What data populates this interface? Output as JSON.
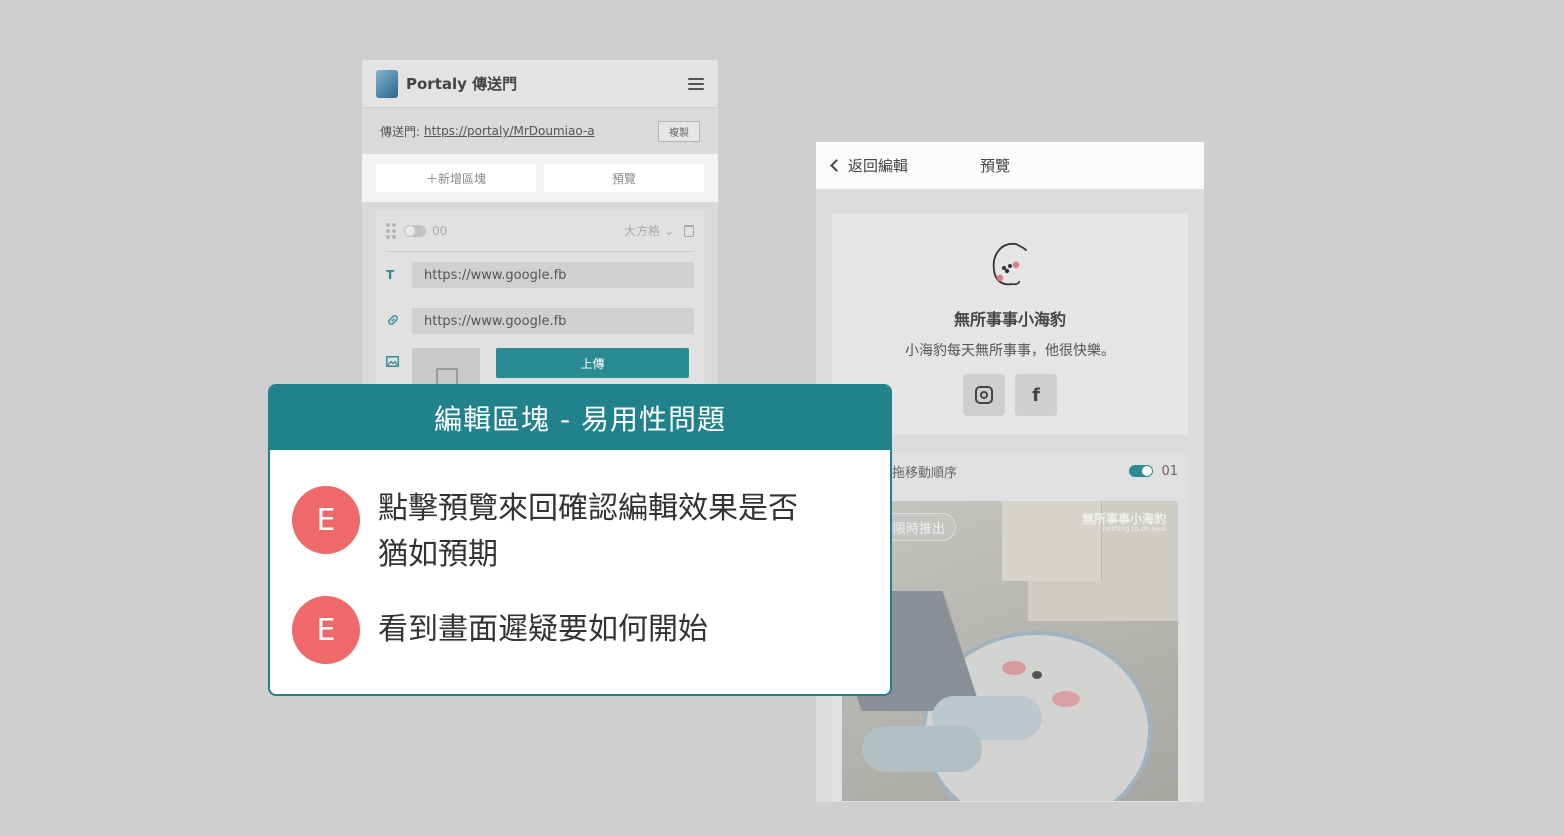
{
  "editor": {
    "app_name": "Portaly 傳送門",
    "portal_label": "傳送門:",
    "portal_url": "https://portaly/MrDoumiao-a",
    "copy_label": "複製",
    "add_block_label": "＋新增區塊",
    "preview_label": "預覽",
    "block": {
      "index": "00",
      "size_label": "大方格 ⌄",
      "title_value": "https://www.google.fb",
      "link_value": "https://www.google.fb",
      "upload_label": "上傳"
    }
  },
  "preview": {
    "back_label": "返回編輯",
    "title": "預覽",
    "profile": {
      "name": "無所事事小海豹",
      "description": "小海豹每天無所事事，他很快樂。",
      "socials": [
        "instagram-icon",
        "facebook-icon"
      ],
      "facebook_glyph": "f"
    },
    "media_block": {
      "drag_label": "拖移動順序",
      "index": "01",
      "tag": "限時推出",
      "watermark": "無所事事小海豹",
      "watermark_sub": "nothing to do seal"
    }
  },
  "callout": {
    "title": "編輯區塊 - 易用性問題",
    "items": [
      {
        "badge": "E",
        "text": "點擊預覽來回確認編輯效果是否猶如預期"
      },
      {
        "badge": "E",
        "text": "看到畫面遲疑要如何開始"
      }
    ]
  },
  "colors": {
    "accent": "#21828b",
    "badge": "#f0696a",
    "background": "#cfcfd1"
  }
}
